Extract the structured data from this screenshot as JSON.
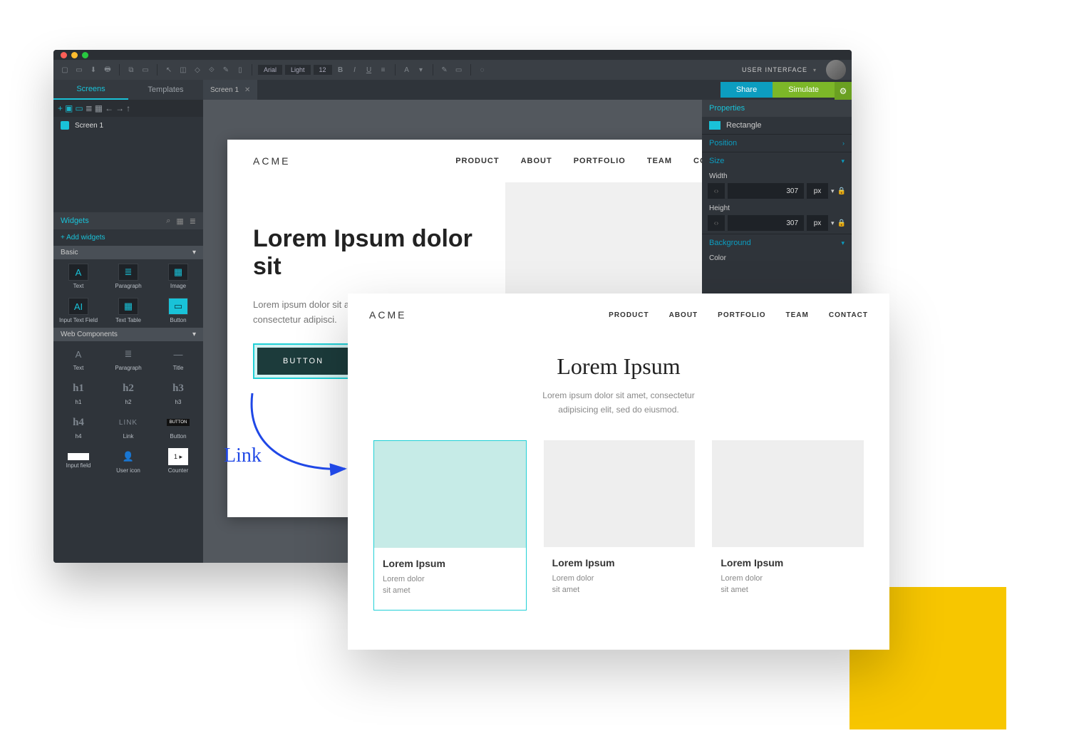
{
  "toolbar": {
    "font_family": "Arial",
    "font_weight": "Light",
    "font_size": "12",
    "user_label": "USER INTERFACE"
  },
  "left_tabs": {
    "screens": "Screens",
    "templates": "Templates"
  },
  "screen_tab": "Screen 1",
  "actions": {
    "share": "Share",
    "simulate": "Simulate"
  },
  "sidebar": {
    "item1": "Screen 1",
    "widgets_head": "Widgets",
    "add_widgets": "+ Add widgets",
    "cat_basic": "Basic",
    "basic": {
      "text": "Text",
      "paragraph": "Paragraph",
      "image": "Image",
      "input_text": "Input Text Field",
      "text_table": "Text Table",
      "button": "Button"
    },
    "cat_web": "Web Components",
    "web": {
      "text": "Text",
      "paragraph": "Paragraph",
      "title": "Title",
      "h1": "h1",
      "h2": "h2",
      "h3": "h3",
      "h4": "h4",
      "link": "Link",
      "button": "Button",
      "input": "Input field",
      "user": "User icon",
      "counter": "Counter"
    }
  },
  "artboard1": {
    "brand": "ACME",
    "nav": {
      "product": "PRODUCT",
      "about": "ABOUT",
      "portfolio": "PORTFOLIO",
      "team": "TEAM",
      "contact": "CONTACT"
    },
    "headline": "Lorem Ipsum dolor sit",
    "body": "Lorem ipsum dolor sit amet, consectetur adipisci.",
    "button": "BUTTON"
  },
  "props": {
    "head": "Properties",
    "shape": "Rectangle",
    "position": "Position",
    "size": "Size",
    "width_label": "Width",
    "width_value": "307",
    "width_unit": "px",
    "height_label": "Height",
    "height_value": "307",
    "height_unit": "px",
    "background": "Background",
    "color": "Color"
  },
  "preview": {
    "brand": "ACME",
    "nav": {
      "product": "PRODUCT",
      "about": "ABOUT",
      "portfolio": "PORTFOLIO",
      "team": "TEAM",
      "contact": "CONTACT"
    },
    "headline": "Lorem Ipsum",
    "sub1": "Lorem ipsum dolor sit amet, consectetur",
    "sub2": "adipisicing elit, sed do eiusmod.",
    "card_title": "Lorem Ipsum",
    "card_l1": "Lorem dolor",
    "card_l2": "sit amet"
  },
  "annotation": {
    "link": "Link"
  }
}
